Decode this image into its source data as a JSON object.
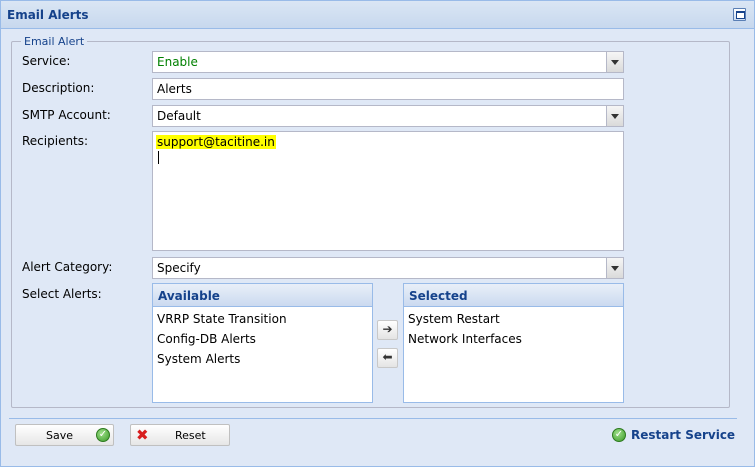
{
  "panel": {
    "title": "Email Alerts"
  },
  "fieldset": {
    "legend": "Email Alert"
  },
  "form": {
    "service": {
      "label": "Service:",
      "value": "Enable"
    },
    "description": {
      "label": "Description:",
      "value": "Alerts"
    },
    "smtp_account": {
      "label": "SMTP Account:",
      "value": "Default"
    },
    "recipients": {
      "label": "Recipients:",
      "value": "support@tacitine.in"
    },
    "alert_category": {
      "label": "Alert Category:",
      "value": "Specify"
    },
    "select_alerts": {
      "label": "Select Alerts:"
    }
  },
  "available": {
    "header": "Available",
    "items": [
      "VRRP State Transition",
      "Config-DB Alerts",
      "System Alerts"
    ]
  },
  "selected": {
    "header": "Selected",
    "items": [
      "System Restart",
      "Network Interfaces"
    ]
  },
  "move_buttons": {
    "add": "➔",
    "remove": "⬅"
  },
  "footer": {
    "save_label": "Save",
    "reset_label": "Reset",
    "restart_label": "Restart Service"
  },
  "colors": {
    "header_text": "#15428b",
    "panel_bg": "#dfe8f6",
    "enable_text": "#008000",
    "highlight": "#ffff00"
  }
}
